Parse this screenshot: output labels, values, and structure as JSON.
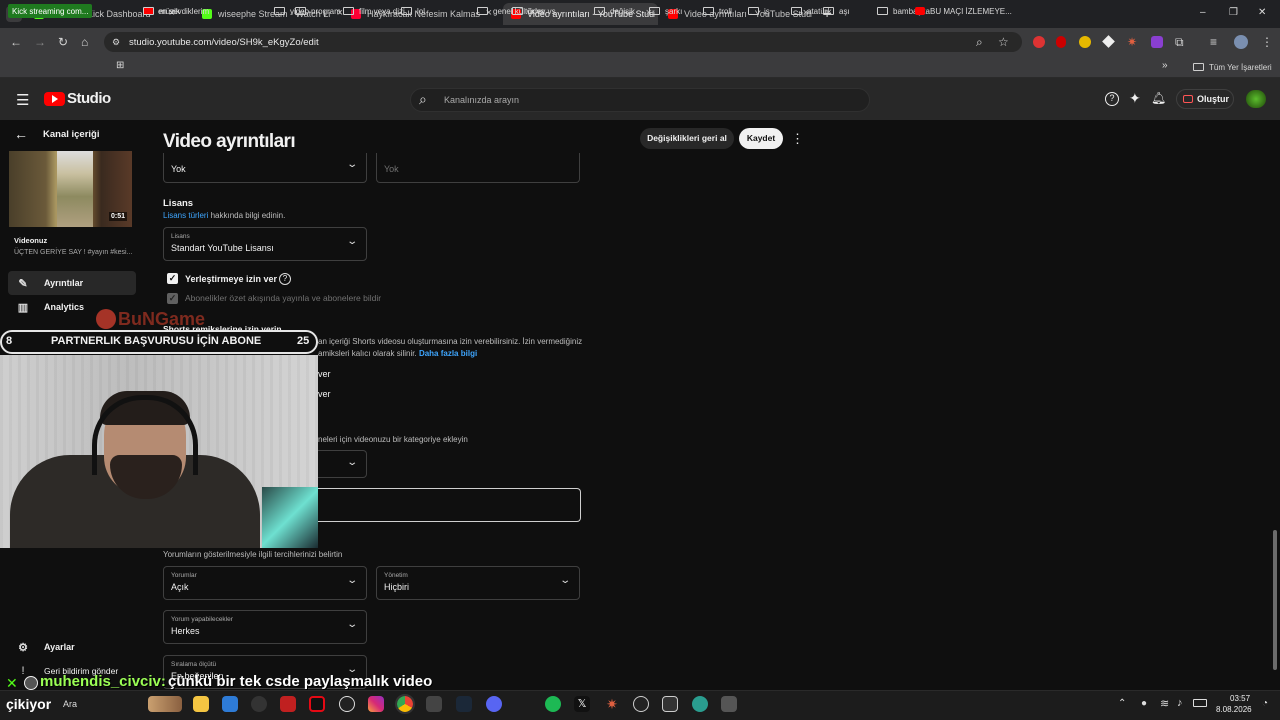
{
  "browser": {
    "tabs": [
      {
        "title": "Stream - Kick Dashboard",
        "color": "#53fc18",
        "active": false
      },
      {
        "title": "wiseephe Stream - Watch Li",
        "color": "#53fc18",
        "active": false
      },
      {
        "title": "Haykıracak Nefesim Kalmas",
        "color": "#ff0033",
        "active": false
      },
      {
        "title": "Video ayrıntıları - YouTube Studi",
        "color": "#ff0000",
        "active": true
      },
      {
        "title": "Video ayrıntıları - YouTube Studi",
        "color": "#ff0000",
        "active": false
      }
    ],
    "new_tab": "+",
    "url": "studio.youtube.com/video/SH9k_eKgyZo/edit",
    "bookmarks": [
      "Kick streaming com...",
      "en sevdiklerim",
      "müzik",
      "video",
      "program",
      "film veya dizi",
      "lol",
      "genel kültür vs",
      "ödev vs",
      "değişik",
      "şarkı",
      "troll",
      "iş",
      "atatürk",
      "aşı",
      "bambaşka",
      "BU MAÇI İZLEMEYE..."
    ],
    "all_bookmarks": "Tüm Yer İşaretleri",
    "window_controls": {
      "minimize": "–",
      "restore": "❐",
      "close": "✕"
    }
  },
  "studio": {
    "logo": "Studio",
    "search_placeholder": "Kanalınızda arayın",
    "create_label": "Oluştur",
    "sidebar": {
      "back_label": "Kanal içeriği",
      "video_duration": "0:51",
      "video_heading": "Videonuz",
      "video_title": "ÜÇTEN GERİYE SAY ! #yayın #kesi...",
      "items": [
        {
          "label": "Ayrıntılar",
          "icon": "pencil-icon",
          "active": true
        },
        {
          "label": "Analytics",
          "icon": "analytics-icon",
          "active": false
        }
      ],
      "settings_label": "Ayarlar",
      "feedback_label": "Geri bildirim gönder"
    },
    "page_title": "Video ayrıntıları",
    "undo_label": "Değişiklikleri geri al",
    "save_label": "Kaydet",
    "form": {
      "top_left_value": "Yok",
      "top_right_placeholder": "Yok",
      "license_heading": "Lisans",
      "license_link": "Lisans türleri",
      "license_help": " hakkında bilgi edinin.",
      "license_label": "Lisans",
      "license_value": "Standart YouTube Lisansı",
      "embed_label": "Yerleştirmeye izin ver",
      "subscriptions_label": "Abonelikler özet akışında yayınla ve abonelere bildir",
      "shorts_heading": "Shorts remikslerine izin verin",
      "shorts_desc1": "an içeriği Shorts videosu oluşturmasına izin verebilirsiniz. İzin vermediğiniz",
      "shorts_desc2": "amiksleri kalıcı olarak silinir.",
      "shorts_more": "Daha fazla bilgi",
      "option1": "ver",
      "option2": "ver",
      "category_desc": "neleri için videonuzu bir kategoriye ekleyin",
      "comments_desc": "Yorumların gösterilmesiyle ilgili tercihlerinizi belirtin",
      "comments_label": "Yorumlar",
      "comments_value": "Açık",
      "moderation_label": "Yönetim",
      "moderation_value": "Hiçbiri",
      "who_can_comment_label": "Yorum yapabilecekler",
      "who_can_comment_value": "Herkes",
      "sort_label": "Sıralama ölçütü",
      "sort_value": "En beğenilen"
    }
  },
  "stream_overlay": {
    "left_number": "8",
    "goal_text": "PARTNERLIK BAŞVURUSU İÇİN ABONE",
    "right_number": "25",
    "watermark": "BuNGame",
    "chat_user": "muhendis_civciv:",
    "chat_message": " çünkü bir tek csde paylaşmalık video",
    "ticker": "çikiyor"
  },
  "taskbar": {
    "search": "Ara",
    "time": "03:57",
    "date": "8.08.2026"
  }
}
